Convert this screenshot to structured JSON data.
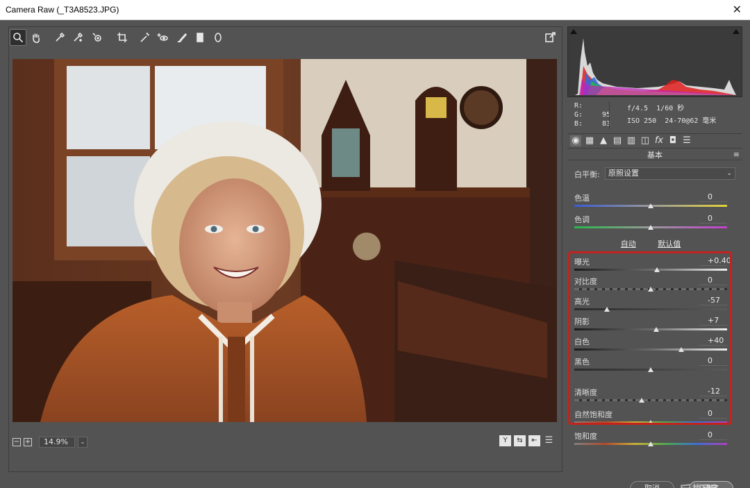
{
  "window": {
    "title": "Camera Raw (_T3A8523.JPG)",
    "close_glyph": "✕"
  },
  "toolbar": {
    "tools": [
      {
        "name": "zoom-tool",
        "glyph": "🔍"
      },
      {
        "name": "hand-tool",
        "glyph": "✋"
      },
      {
        "name": "white-balance-tool",
        "glyph": "⁄"
      },
      {
        "name": "color-sampler-tool",
        "glyph": "⁄"
      },
      {
        "name": "target-adjustment-tool",
        "glyph": "◎"
      },
      {
        "name": "crop-tool",
        "glyph": "⌗"
      },
      {
        "name": "spot-removal-tool",
        "glyph": "✎"
      },
      {
        "name": "red-eye-tool",
        "glyph": "+◉"
      },
      {
        "name": "adjustment-brush-tool",
        "glyph": "✐"
      },
      {
        "name": "graduated-filter-tool",
        "glyph": "▮"
      },
      {
        "name": "radial-filter-tool",
        "glyph": "◯"
      }
    ],
    "fullscreen_glyph": "⇱"
  },
  "zoom": {
    "minus": "−",
    "plus": "+",
    "value": "14.9%",
    "dropdown": "⌄"
  },
  "view_buttons": [
    "Y",
    "⇆",
    "⇤",
    "☰"
  ],
  "readout": {
    "r_label": "R:",
    "r_value": "",
    "g_label": "G:",
    "g_value": "95",
    "b_label": "B:",
    "b_value": "83",
    "aperture": "f/4.5",
    "shutter": "1/60 秒",
    "iso": "ISO 250",
    "lens": "24-70@62 毫米"
  },
  "panel_tabs": [
    "◉",
    "▦",
    "▲",
    "▤",
    "▥",
    "◫",
    "fx",
    "◘",
    "☰"
  ],
  "section_title": "基本",
  "section_menu": "≡",
  "white_balance": {
    "label": "白平衡:",
    "value": "原照设置",
    "caret": "⌄"
  },
  "auto_links": {
    "auto": "自动",
    "default": "默认值"
  },
  "sliders": [
    {
      "id": "temp",
      "label": "色温",
      "value": "0",
      "pos": 0.5
    },
    {
      "id": "tint",
      "label": "色调",
      "value": "0",
      "pos": 0.5
    },
    {
      "id": "exposure",
      "label": "曝光",
      "value": "+0.40",
      "pos": 0.54
    },
    {
      "id": "contrast",
      "label": "对比度",
      "value": "0",
      "pos": 0.5
    },
    {
      "id": "highlights",
      "label": "高光",
      "value": "-57",
      "pos": 0.215
    },
    {
      "id": "shadows",
      "label": "阴影",
      "value": "+7",
      "pos": 0.535
    },
    {
      "id": "whites",
      "label": "白色",
      "value": "+40",
      "pos": 0.7
    },
    {
      "id": "blacks",
      "label": "黑色",
      "value": "0",
      "pos": 0.5
    },
    {
      "id": "clarity",
      "label": "清晰度",
      "value": "-12",
      "pos": 0.44
    },
    {
      "id": "vibrance",
      "label": "自然饱和度",
      "value": "0",
      "pos": 0.5
    },
    {
      "id": "saturation",
      "label": "饱和度",
      "value": "0",
      "pos": 0.5
    }
  ],
  "buttons": {
    "cancel": "取消",
    "ok": "确定"
  },
  "watermark": "后期强",
  "colors": {
    "highlight_box": "#c4221d",
    "panel_bg": "#535353"
  }
}
